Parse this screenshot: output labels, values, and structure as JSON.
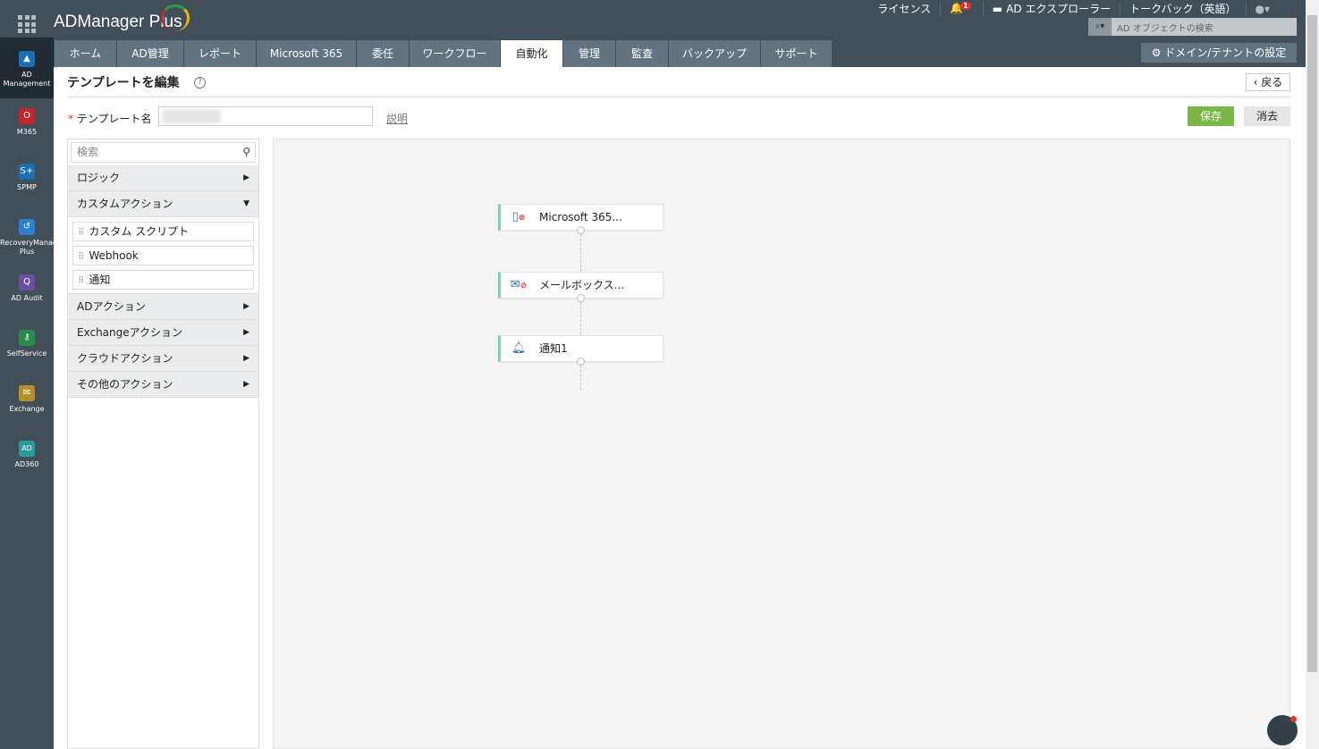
{
  "app": {
    "name": "ADManager Plus"
  },
  "topnav": {
    "license": "ライセンス",
    "notifications": "1",
    "explorer": "AD エクスプローラー",
    "talkback": "トークバック（英語）"
  },
  "search": {
    "placeholder": "AD オブジェクトの検索"
  },
  "domain_settings": "ドメイン/テナントの設定",
  "rail": [
    {
      "label": "AD Management",
      "icon": "AD"
    },
    {
      "label": "M365",
      "icon": "O"
    },
    {
      "label": "SPMP",
      "icon": "S+"
    },
    {
      "label": "RecoveryManager Plus",
      "icon": "↺"
    },
    {
      "label": "AD Audit",
      "icon": "Q"
    },
    {
      "label": "SelfService",
      "icon": "⚷"
    },
    {
      "label": "Exchange",
      "icon": "✉"
    },
    {
      "label": "AD360",
      "icon": "AD"
    }
  ],
  "rail_colors": [
    "#1a6fb5",
    "#c1272d",
    "#1a6fb5",
    "#2a7fd0",
    "#6b4fa0",
    "#2a8a4a",
    "#b5902a",
    "#2a9a9a"
  ],
  "tabs": [
    "ホーム",
    "AD管理",
    "レポート",
    "Microsoft 365",
    "委任",
    "ワークフロー",
    "自動化",
    "管理",
    "監査",
    "バックアップ",
    "サポート"
  ],
  "active_tab": "自動化",
  "page": {
    "title": "テンプレートを編集",
    "back": "戻る",
    "template_label": "テンプレート名",
    "description_link": "説明",
    "save": "保存",
    "clear": "消去"
  },
  "palette": {
    "search_placeholder": "検索",
    "categories": {
      "logic": "ロジック",
      "custom": "カスタムアクション",
      "ad": "ADアクション",
      "exchange": "Exchangeアクション",
      "cloud": "クラウドアクション",
      "other": "その他のアクション"
    },
    "custom_items": [
      "カスタム スクリプト",
      "Webhook",
      "通知"
    ]
  },
  "nodes": [
    "Microsoft 365...",
    "メールボックス...",
    "通知1"
  ]
}
